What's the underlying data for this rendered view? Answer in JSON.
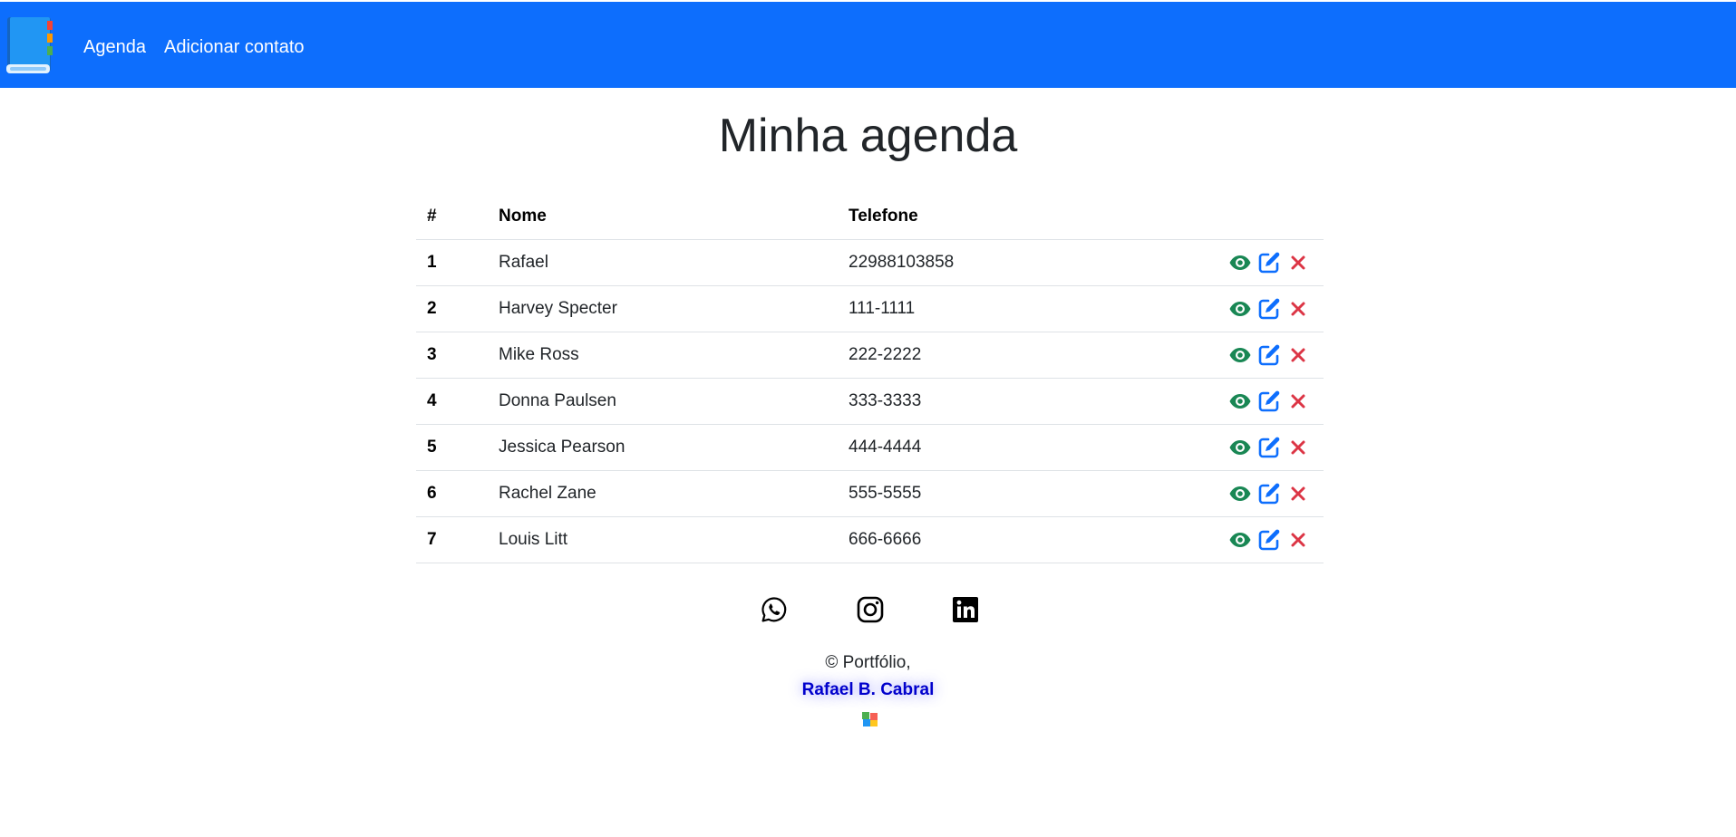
{
  "nav": {
    "logo_icon": "address-book-icon",
    "links": [
      "Agenda",
      "Adicionar contato"
    ]
  },
  "page": {
    "title": "Minha agenda"
  },
  "table": {
    "headers": [
      "#",
      "Nome",
      "Telefone",
      ""
    ],
    "rows": [
      {
        "id": "1",
        "name": "Rafael",
        "phone": "22988103858"
      },
      {
        "id": "2",
        "name": "Harvey Specter",
        "phone": "111-1111"
      },
      {
        "id": "3",
        "name": "Mike Ross",
        "phone": "222-2222"
      },
      {
        "id": "4",
        "name": "Donna Paulsen",
        "phone": "333-3333"
      },
      {
        "id": "5",
        "name": "Jessica Pearson",
        "phone": "444-4444"
      },
      {
        "id": "6",
        "name": "Rachel Zane",
        "phone": "555-5555"
      },
      {
        "id": "7",
        "name": "Louis Litt",
        "phone": "666-6666"
      }
    ],
    "row_actions": [
      "eye-icon",
      "edit-icon",
      "close-icon"
    ]
  },
  "footer": {
    "social_icons": [
      "whatsapp-icon",
      "instagram-icon",
      "linkedin-icon"
    ],
    "copyright": "© Portfólio,",
    "author": "Rafael B. Cabral",
    "portfolio_icon": "windows-icon"
  },
  "colors": {
    "navbar": "#0d6efd",
    "view": "#198754",
    "edit": "#0d6efd",
    "delete": "#dc3545",
    "author": "#0000cc"
  }
}
